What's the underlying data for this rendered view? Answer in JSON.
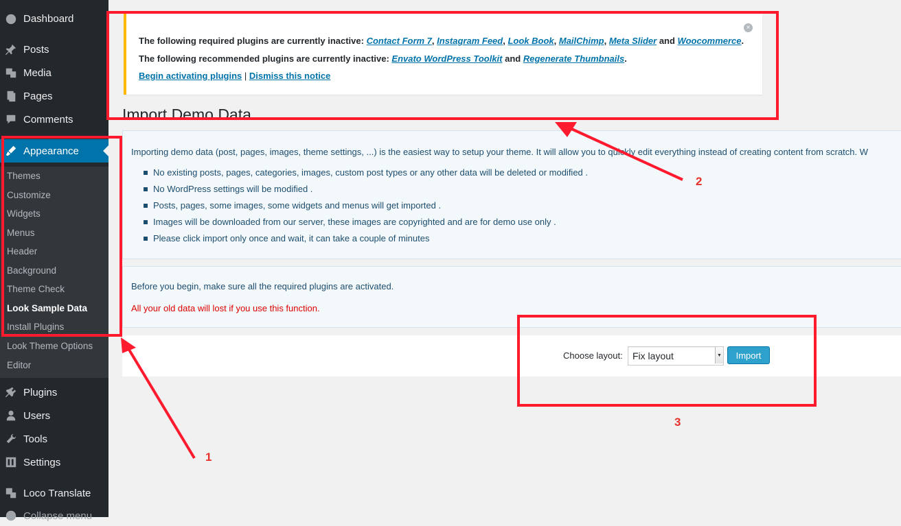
{
  "sidebar": {
    "menu": [
      {
        "label": "Dashboard",
        "icon": "dashboard-icon"
      },
      {
        "label": "Posts",
        "icon": "pin-icon"
      },
      {
        "label": "Media",
        "icon": "media-icon"
      },
      {
        "label": "Pages",
        "icon": "pages-icon"
      },
      {
        "label": "Comments",
        "icon": "comment-icon"
      },
      {
        "label": "Appearance",
        "icon": "brush-icon"
      }
    ],
    "submenu": [
      "Themes",
      "Customize",
      "Widgets",
      "Menus",
      "Header",
      "Background",
      "Theme Check",
      "Look Sample Data",
      "Install Plugins",
      "Look Theme Options",
      "Editor"
    ],
    "menu_lower": [
      {
        "label": "Plugins",
        "icon": "plugin-icon"
      },
      {
        "label": "Users",
        "icon": "user-icon"
      },
      {
        "label": "Tools",
        "icon": "wrench-icon"
      },
      {
        "label": "Settings",
        "icon": "settings-icon"
      },
      {
        "label": "Loco Translate",
        "icon": "translate-icon"
      },
      {
        "label": "Collapse menu",
        "icon": "collapse-icon"
      }
    ]
  },
  "notice": {
    "required_prefix": "The following required plugins are currently inactive: ",
    "required_plugins": [
      "Contact Form 7",
      "Instagram Feed",
      "Look Book",
      "MailChimp",
      "Meta Slider",
      "Woocommerce"
    ],
    "sep": ", ",
    "and": " and ",
    "end": ".",
    "recommended_prefix": "The following recommended plugins are currently inactive: ",
    "recommended_plugins": [
      "Envato WordPress Toolkit",
      "Regenerate Thumbnails"
    ],
    "begin_link": "Begin activating plugins",
    "divider": " | ",
    "dismiss_link": "Dismiss this notice",
    "close_glyph": "×"
  },
  "page_title": "Import Demo Data",
  "intro_text": "Importing demo data (post, pages, images, theme settings, ...) is the easiest way to setup your theme. It will allow you to quickly edit everything instead of creating content from scratch. W",
  "bullets": [
    "No existing posts, pages, categories, images, custom post types or any other data will be deleted or modified .",
    "No WordPress settings will be modified .",
    "Posts, pages, some images, some widgets and menus will get imported .",
    "Images will be downloaded from our server, these images are copyrighted and are for demo use only .",
    "Please click import only once and wait, it can take a couple of minutes"
  ],
  "before_text": "Before you begin, make sure all the required plugins are activated.",
  "warning_text": "All your old data will lost if you use this function.",
  "import": {
    "label": "Choose layout:",
    "selected": "Fix layout",
    "button": "Import"
  },
  "annotations": [
    "1",
    "2",
    "3"
  ],
  "colors": {
    "annotation": "#ff1a2e",
    "accent": "#0073aa",
    "warning": "#dd0000"
  }
}
